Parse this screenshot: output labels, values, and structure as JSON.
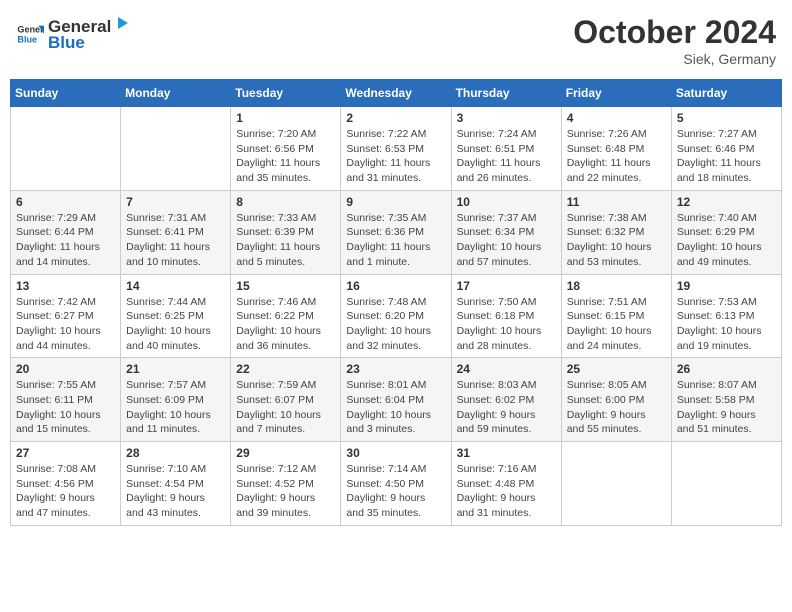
{
  "header": {
    "logo_general": "General",
    "logo_blue": "Blue",
    "month": "October 2024",
    "location": "Siek, Germany"
  },
  "weekdays": [
    "Sunday",
    "Monday",
    "Tuesday",
    "Wednesday",
    "Thursday",
    "Friday",
    "Saturday"
  ],
  "weeks": [
    [
      {
        "day": "",
        "info": ""
      },
      {
        "day": "",
        "info": ""
      },
      {
        "day": "1",
        "info": "Sunrise: 7:20 AM\nSunset: 6:56 PM\nDaylight: 11 hours\nand 35 minutes."
      },
      {
        "day": "2",
        "info": "Sunrise: 7:22 AM\nSunset: 6:53 PM\nDaylight: 11 hours\nand 31 minutes."
      },
      {
        "day": "3",
        "info": "Sunrise: 7:24 AM\nSunset: 6:51 PM\nDaylight: 11 hours\nand 26 minutes."
      },
      {
        "day": "4",
        "info": "Sunrise: 7:26 AM\nSunset: 6:48 PM\nDaylight: 11 hours\nand 22 minutes."
      },
      {
        "day": "5",
        "info": "Sunrise: 7:27 AM\nSunset: 6:46 PM\nDaylight: 11 hours\nand 18 minutes."
      }
    ],
    [
      {
        "day": "6",
        "info": "Sunrise: 7:29 AM\nSunset: 6:44 PM\nDaylight: 11 hours\nand 14 minutes."
      },
      {
        "day": "7",
        "info": "Sunrise: 7:31 AM\nSunset: 6:41 PM\nDaylight: 11 hours\nand 10 minutes."
      },
      {
        "day": "8",
        "info": "Sunrise: 7:33 AM\nSunset: 6:39 PM\nDaylight: 11 hours\nand 5 minutes."
      },
      {
        "day": "9",
        "info": "Sunrise: 7:35 AM\nSunset: 6:36 PM\nDaylight: 11 hours\nand 1 minute."
      },
      {
        "day": "10",
        "info": "Sunrise: 7:37 AM\nSunset: 6:34 PM\nDaylight: 10 hours\nand 57 minutes."
      },
      {
        "day": "11",
        "info": "Sunrise: 7:38 AM\nSunset: 6:32 PM\nDaylight: 10 hours\nand 53 minutes."
      },
      {
        "day": "12",
        "info": "Sunrise: 7:40 AM\nSunset: 6:29 PM\nDaylight: 10 hours\nand 49 minutes."
      }
    ],
    [
      {
        "day": "13",
        "info": "Sunrise: 7:42 AM\nSunset: 6:27 PM\nDaylight: 10 hours\nand 44 minutes."
      },
      {
        "day": "14",
        "info": "Sunrise: 7:44 AM\nSunset: 6:25 PM\nDaylight: 10 hours\nand 40 minutes."
      },
      {
        "day": "15",
        "info": "Sunrise: 7:46 AM\nSunset: 6:22 PM\nDaylight: 10 hours\nand 36 minutes."
      },
      {
        "day": "16",
        "info": "Sunrise: 7:48 AM\nSunset: 6:20 PM\nDaylight: 10 hours\nand 32 minutes."
      },
      {
        "day": "17",
        "info": "Sunrise: 7:50 AM\nSunset: 6:18 PM\nDaylight: 10 hours\nand 28 minutes."
      },
      {
        "day": "18",
        "info": "Sunrise: 7:51 AM\nSunset: 6:15 PM\nDaylight: 10 hours\nand 24 minutes."
      },
      {
        "day": "19",
        "info": "Sunrise: 7:53 AM\nSunset: 6:13 PM\nDaylight: 10 hours\nand 19 minutes."
      }
    ],
    [
      {
        "day": "20",
        "info": "Sunrise: 7:55 AM\nSunset: 6:11 PM\nDaylight: 10 hours\nand 15 minutes."
      },
      {
        "day": "21",
        "info": "Sunrise: 7:57 AM\nSunset: 6:09 PM\nDaylight: 10 hours\nand 11 minutes."
      },
      {
        "day": "22",
        "info": "Sunrise: 7:59 AM\nSunset: 6:07 PM\nDaylight: 10 hours\nand 7 minutes."
      },
      {
        "day": "23",
        "info": "Sunrise: 8:01 AM\nSunset: 6:04 PM\nDaylight: 10 hours\nand 3 minutes."
      },
      {
        "day": "24",
        "info": "Sunrise: 8:03 AM\nSunset: 6:02 PM\nDaylight: 9 hours\nand 59 minutes."
      },
      {
        "day": "25",
        "info": "Sunrise: 8:05 AM\nSunset: 6:00 PM\nDaylight: 9 hours\nand 55 minutes."
      },
      {
        "day": "26",
        "info": "Sunrise: 8:07 AM\nSunset: 5:58 PM\nDaylight: 9 hours\nand 51 minutes."
      }
    ],
    [
      {
        "day": "27",
        "info": "Sunrise: 7:08 AM\nSunset: 4:56 PM\nDaylight: 9 hours\nand 47 minutes."
      },
      {
        "day": "28",
        "info": "Sunrise: 7:10 AM\nSunset: 4:54 PM\nDaylight: 9 hours\nand 43 minutes."
      },
      {
        "day": "29",
        "info": "Sunrise: 7:12 AM\nSunset: 4:52 PM\nDaylight: 9 hours\nand 39 minutes."
      },
      {
        "day": "30",
        "info": "Sunrise: 7:14 AM\nSunset: 4:50 PM\nDaylight: 9 hours\nand 35 minutes."
      },
      {
        "day": "31",
        "info": "Sunrise: 7:16 AM\nSunset: 4:48 PM\nDaylight: 9 hours\nand 31 minutes."
      },
      {
        "day": "",
        "info": ""
      },
      {
        "day": "",
        "info": ""
      }
    ]
  ]
}
